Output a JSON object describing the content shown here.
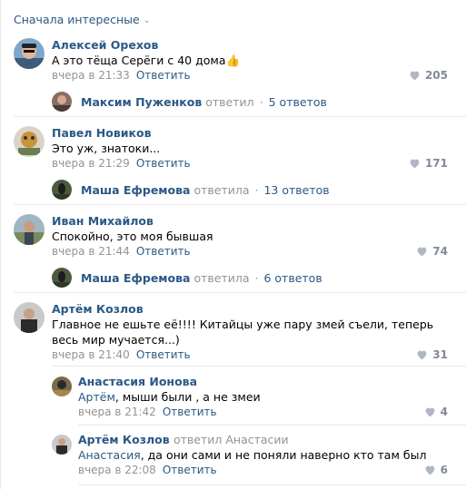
{
  "sort_label": "Сначала интересные",
  "reply_label": "Ответить",
  "comments": [
    {
      "author": "Алексей Орехов",
      "text": "А это тёща Серёги с 40 дома",
      "emoji": "👍",
      "time": "вчера в 21:33",
      "likes": "205",
      "thread": {
        "name": "Максим Пуженков",
        "verb": "ответил",
        "count": "5 ответов"
      }
    },
    {
      "author": "Павел Новиков",
      "text": "Это уж, знатоки...",
      "time": "вчера в 21:29",
      "likes": "171",
      "thread": {
        "name": "Маша Ефремова",
        "verb": "ответила",
        "count": "13 ответов"
      }
    },
    {
      "author": "Иван Михайлов",
      "text": "Спокойно, это моя бывшая",
      "time": "вчера в 21:44",
      "likes": "74",
      "thread": {
        "name": "Маша Ефремова",
        "verb": "ответила",
        "count": "6 ответов"
      }
    },
    {
      "author": "Артём Козлов",
      "text": "Главное не ешьте её!!!! Китайцы уже пару змей съели, теперь весь мир мучается...)",
      "time": "вчера в 21:40",
      "likes": "31",
      "replies": [
        {
          "author": "Анастасия Ионова",
          "mention": "Артём",
          "text": ", мыши были , а не змеи",
          "time": "вчера в 21:42",
          "likes": "4"
        },
        {
          "author": "Артём Козлов",
          "author_suffix": "ответил Анастасии",
          "mention": "Анастасия",
          "text": ", да они сами и не поняли наверно кто там был",
          "time": "вчера в 22:08",
          "likes": "6"
        }
      ]
    }
  ],
  "colors": {
    "link": "#2a5885",
    "muted": "#939393",
    "separator": "#e7e8ec",
    "heart": "#aeb7c2"
  }
}
